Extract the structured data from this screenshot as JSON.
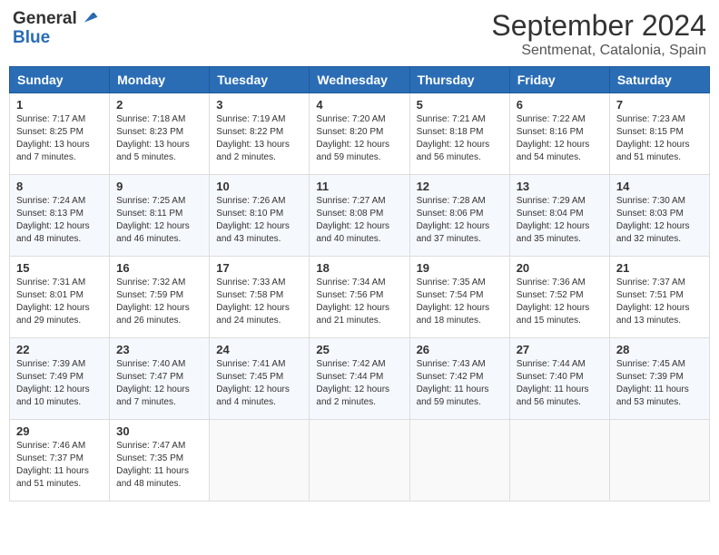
{
  "header": {
    "logo_general": "General",
    "logo_blue": "Blue",
    "month_title": "September 2024",
    "location": "Sentmenat, Catalonia, Spain"
  },
  "days_of_week": [
    "Sunday",
    "Monday",
    "Tuesday",
    "Wednesday",
    "Thursday",
    "Friday",
    "Saturday"
  ],
  "weeks": [
    [
      {
        "day": "1",
        "sunrise": "7:17 AM",
        "sunset": "8:25 PM",
        "daylight": "13 hours and 7 minutes."
      },
      {
        "day": "2",
        "sunrise": "7:18 AM",
        "sunset": "8:23 PM",
        "daylight": "13 hours and 5 minutes."
      },
      {
        "day": "3",
        "sunrise": "7:19 AM",
        "sunset": "8:22 PM",
        "daylight": "13 hours and 2 minutes."
      },
      {
        "day": "4",
        "sunrise": "7:20 AM",
        "sunset": "8:20 PM",
        "daylight": "12 hours and 59 minutes."
      },
      {
        "day": "5",
        "sunrise": "7:21 AM",
        "sunset": "8:18 PM",
        "daylight": "12 hours and 56 minutes."
      },
      {
        "day": "6",
        "sunrise": "7:22 AM",
        "sunset": "8:16 PM",
        "daylight": "12 hours and 54 minutes."
      },
      {
        "day": "7",
        "sunrise": "7:23 AM",
        "sunset": "8:15 PM",
        "daylight": "12 hours and 51 minutes."
      }
    ],
    [
      {
        "day": "8",
        "sunrise": "7:24 AM",
        "sunset": "8:13 PM",
        "daylight": "12 hours and 48 minutes."
      },
      {
        "day": "9",
        "sunrise": "7:25 AM",
        "sunset": "8:11 PM",
        "daylight": "12 hours and 46 minutes."
      },
      {
        "day": "10",
        "sunrise": "7:26 AM",
        "sunset": "8:10 PM",
        "daylight": "12 hours and 43 minutes."
      },
      {
        "day": "11",
        "sunrise": "7:27 AM",
        "sunset": "8:08 PM",
        "daylight": "12 hours and 40 minutes."
      },
      {
        "day": "12",
        "sunrise": "7:28 AM",
        "sunset": "8:06 PM",
        "daylight": "12 hours and 37 minutes."
      },
      {
        "day": "13",
        "sunrise": "7:29 AM",
        "sunset": "8:04 PM",
        "daylight": "12 hours and 35 minutes."
      },
      {
        "day": "14",
        "sunrise": "7:30 AM",
        "sunset": "8:03 PM",
        "daylight": "12 hours and 32 minutes."
      }
    ],
    [
      {
        "day": "15",
        "sunrise": "7:31 AM",
        "sunset": "8:01 PM",
        "daylight": "12 hours and 29 minutes."
      },
      {
        "day": "16",
        "sunrise": "7:32 AM",
        "sunset": "7:59 PM",
        "daylight": "12 hours and 26 minutes."
      },
      {
        "day": "17",
        "sunrise": "7:33 AM",
        "sunset": "7:58 PM",
        "daylight": "12 hours and 24 minutes."
      },
      {
        "day": "18",
        "sunrise": "7:34 AM",
        "sunset": "7:56 PM",
        "daylight": "12 hours and 21 minutes."
      },
      {
        "day": "19",
        "sunrise": "7:35 AM",
        "sunset": "7:54 PM",
        "daylight": "12 hours and 18 minutes."
      },
      {
        "day": "20",
        "sunrise": "7:36 AM",
        "sunset": "7:52 PM",
        "daylight": "12 hours and 15 minutes."
      },
      {
        "day": "21",
        "sunrise": "7:37 AM",
        "sunset": "7:51 PM",
        "daylight": "12 hours and 13 minutes."
      }
    ],
    [
      {
        "day": "22",
        "sunrise": "7:39 AM",
        "sunset": "7:49 PM",
        "daylight": "12 hours and 10 minutes."
      },
      {
        "day": "23",
        "sunrise": "7:40 AM",
        "sunset": "7:47 PM",
        "daylight": "12 hours and 7 minutes."
      },
      {
        "day": "24",
        "sunrise": "7:41 AM",
        "sunset": "7:45 PM",
        "daylight": "12 hours and 4 minutes."
      },
      {
        "day": "25",
        "sunrise": "7:42 AM",
        "sunset": "7:44 PM",
        "daylight": "12 hours and 2 minutes."
      },
      {
        "day": "26",
        "sunrise": "7:43 AM",
        "sunset": "7:42 PM",
        "daylight": "11 hours and 59 minutes."
      },
      {
        "day": "27",
        "sunrise": "7:44 AM",
        "sunset": "7:40 PM",
        "daylight": "11 hours and 56 minutes."
      },
      {
        "day": "28",
        "sunrise": "7:45 AM",
        "sunset": "7:39 PM",
        "daylight": "11 hours and 53 minutes."
      }
    ],
    [
      {
        "day": "29",
        "sunrise": "7:46 AM",
        "sunset": "7:37 PM",
        "daylight": "11 hours and 51 minutes."
      },
      {
        "day": "30",
        "sunrise": "7:47 AM",
        "sunset": "7:35 PM",
        "daylight": "11 hours and 48 minutes."
      },
      null,
      null,
      null,
      null,
      null
    ]
  ]
}
